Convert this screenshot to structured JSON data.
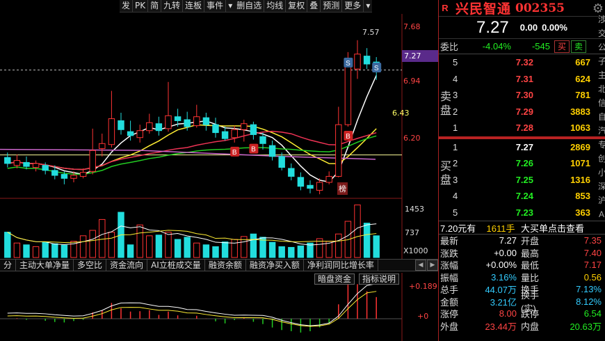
{
  "toolbar": {
    "items": [
      "发",
      "PK",
      "简",
      "九转",
      "连板",
      "事件",
      "删自选",
      "均线",
      "复权",
      "叠",
      "预测",
      "更多"
    ]
  },
  "price_axis": {
    "labels": [
      "7.68",
      "7.27",
      "6.94",
      "6.20"
    ],
    "current": "7.27",
    "ma_value": "6.43",
    "high_mark": "7.57"
  },
  "volume_axis": {
    "labels": [
      "1453",
      "737",
      "X1000"
    ]
  },
  "event_badge": "榜",
  "tabs": [
    "分",
    "主动大单净量",
    "多空比",
    "资金流向",
    "AI立桩成交量",
    "融资余额",
    "融资净买入额",
    "净利润同比增长率"
  ],
  "indicator": {
    "buttons": [
      "暗盘资金",
      "指标说明"
    ],
    "top_label": "+0.189",
    "zero_label": "+0"
  },
  "chart_data": {
    "type": "candlestick",
    "candles": [
      {
        "o": 6.39,
        "c": 6.33,
        "h": 6.44,
        "l": 6.29
      },
      {
        "o": 6.31,
        "c": 6.36,
        "h": 6.42,
        "l": 6.28
      },
      {
        "o": 6.34,
        "c": 6.3,
        "h": 6.4,
        "l": 6.27
      },
      {
        "o": 6.29,
        "c": 6.33,
        "h": 6.36,
        "l": 6.25
      },
      {
        "o": 6.31,
        "c": 6.26,
        "h": 6.34,
        "l": 6.22
      },
      {
        "o": 6.26,
        "c": 6.21,
        "h": 6.31,
        "l": 6.17
      },
      {
        "o": 6.22,
        "c": 6.18,
        "h": 6.25,
        "l": 6.12
      },
      {
        "o": 6.18,
        "c": 6.21,
        "h": 6.25,
        "l": 6.14
      },
      {
        "o": 6.2,
        "c": 6.24,
        "h": 6.28,
        "l": 6.18
      },
      {
        "o": 6.25,
        "c": 6.46,
        "h": 6.68,
        "l": 6.22
      },
      {
        "o": 6.48,
        "c": 6.53,
        "h": 6.63,
        "l": 6.4
      },
      {
        "o": 6.52,
        "c": 6.78,
        "h": 7.06,
        "l": 6.49
      },
      {
        "o": 6.76,
        "c": 6.67,
        "h": 6.84,
        "l": 6.62
      },
      {
        "o": 6.65,
        "c": 6.61,
        "h": 6.76,
        "l": 6.56
      },
      {
        "o": 6.59,
        "c": 6.66,
        "h": 6.72,
        "l": 6.54
      },
      {
        "o": 6.66,
        "c": 6.74,
        "h": 6.83,
        "l": 6.63
      },
      {
        "o": 6.73,
        "c": 6.66,
        "h": 6.8,
        "l": 6.61
      },
      {
        "o": 6.68,
        "c": 6.81,
        "h": 7.15,
        "l": 6.65
      },
      {
        "o": 6.8,
        "c": 6.76,
        "h": 6.88,
        "l": 6.7
      },
      {
        "o": 6.77,
        "c": 6.7,
        "h": 6.85,
        "l": 6.66
      },
      {
        "o": 6.71,
        "c": 6.8,
        "h": 6.92,
        "l": 6.69
      },
      {
        "o": 6.79,
        "c": 6.72,
        "h": 6.84,
        "l": 6.66
      },
      {
        "o": 6.72,
        "c": 6.64,
        "h": 6.79,
        "l": 6.59
      },
      {
        "o": 6.65,
        "c": 6.58,
        "h": 6.7,
        "l": 6.56
      },
      {
        "o": 6.59,
        "c": 6.67,
        "h": 6.71,
        "l": 6.54
      },
      {
        "o": 6.67,
        "c": 6.73,
        "h": 6.77,
        "l": 6.55
      },
      {
        "o": 6.72,
        "c": 6.62,
        "h": 6.75,
        "l": 6.57
      },
      {
        "o": 6.6,
        "c": 6.53,
        "h": 6.64,
        "l": 6.47
      },
      {
        "o": 6.51,
        "c": 6.4,
        "h": 6.56,
        "l": 6.36
      },
      {
        "o": 6.4,
        "c": 6.29,
        "h": 6.44,
        "l": 6.26
      },
      {
        "o": 6.28,
        "c": 6.2,
        "h": 6.33,
        "l": 6.16
      },
      {
        "o": 6.19,
        "c": 6.1,
        "h": 6.24,
        "l": 6.06
      },
      {
        "o": 6.11,
        "c": 6.08,
        "h": 6.16,
        "l": 6.03
      },
      {
        "o": 6.06,
        "c": 6.14,
        "h": 6.18,
        "l": 6.02
      },
      {
        "o": 6.14,
        "c": 6.2,
        "h": 6.25,
        "l": 6.12
      },
      {
        "o": 6.2,
        "c": 6.72,
        "h": 6.9,
        "l": 6.19
      },
      {
        "o": 6.72,
        "c": 7.33,
        "h": 7.45,
        "l": 6.7
      },
      {
        "o": 7.28,
        "c": 7.43,
        "h": 7.57,
        "l": 7.18
      },
      {
        "o": 7.41,
        "c": 7.33,
        "h": 7.49,
        "l": 7.28
      },
      {
        "o": 7.35,
        "c": 7.27,
        "h": 7.4,
        "l": 7.17
      }
    ],
    "volumes": [
      700,
      400,
      350,
      300,
      420,
      380,
      340,
      450,
      600,
      750,
      1050,
      700,
      1250,
      350,
      900,
      600,
      620,
      700,
      500,
      560,
      400,
      350,
      300,
      430,
      500,
      580,
      650,
      560,
      420,
      300,
      280,
      320,
      400,
      520,
      450,
      650,
      1000,
      1453,
      950,
      600
    ],
    "series": [],
    "ylim_price": [
      6.0,
      7.82
    ],
    "ylim_volume": [
      0,
      1500
    ],
    "markers": [
      {
        "label": "S",
        "index": 36
      },
      {
        "label": "S",
        "index": 39
      },
      {
        "label": "B",
        "index": 24
      },
      {
        "label": "B",
        "index": 26
      },
      {
        "label": "B",
        "index": 36
      }
    ]
  },
  "panel": {
    "r": "R",
    "name": "兴民智通",
    "code": "002355",
    "price": "7.27",
    "change": "0.00",
    "pct": "0.00%",
    "weibi_label": "委比",
    "weibi_pct": "-4.04%",
    "weibi_num": "-545",
    "buy_btn": "买",
    "sell_btn": "卖",
    "sell_side": "卖盘",
    "buy_side": "买盘",
    "asks": [
      {
        "lvl": "5",
        "price": "7.32",
        "vol": "667"
      },
      {
        "lvl": "4",
        "price": "7.31",
        "vol": "624"
      },
      {
        "lvl": "3",
        "price": "7.30",
        "vol": "781"
      },
      {
        "lvl": "2",
        "price": "7.29",
        "vol": "3883"
      },
      {
        "lvl": "1",
        "price": "7.28",
        "vol": "1063"
      }
    ],
    "bids": [
      {
        "lvl": "1",
        "price": "7.27",
        "vol": "2869"
      },
      {
        "lvl": "2",
        "price": "7.26",
        "vol": "1071"
      },
      {
        "lvl": "3",
        "price": "7.25",
        "vol": "1316"
      },
      {
        "lvl": "4",
        "price": "7.24",
        "vol": "853"
      },
      {
        "lvl": "5",
        "price": "7.23",
        "vol": "363"
      }
    ],
    "trade_price": "7.20元有",
    "trade_vol": "1611手",
    "trade_note": "大买单点击查看",
    "stats": [
      [
        "最新",
        "7.27",
        "开盘",
        "7.35"
      ],
      [
        "涨跌",
        "+0.00",
        "最高",
        "7.40"
      ],
      [
        "涨幅",
        "+0.00%",
        "最低",
        "7.17"
      ],
      [
        "振幅",
        "3.16%",
        "量比",
        "0.56"
      ],
      [
        "总手",
        "44.07万",
        "换手",
        "7.13%"
      ],
      [
        "金额",
        "3.21亿",
        "换手(实)",
        "8.12%"
      ],
      [
        "涨停",
        "8.00",
        "跌停",
        "6.54"
      ],
      [
        "外盘",
        "23.44万",
        "内盘",
        "20.63万"
      ]
    ],
    "edge_chars": [
      "涉",
      "交",
      "公",
      "子",
      "主",
      "北",
      "信",
      "自",
      "汽",
      "专",
      "创",
      "小",
      "深",
      "沪",
      "A"
    ]
  }
}
